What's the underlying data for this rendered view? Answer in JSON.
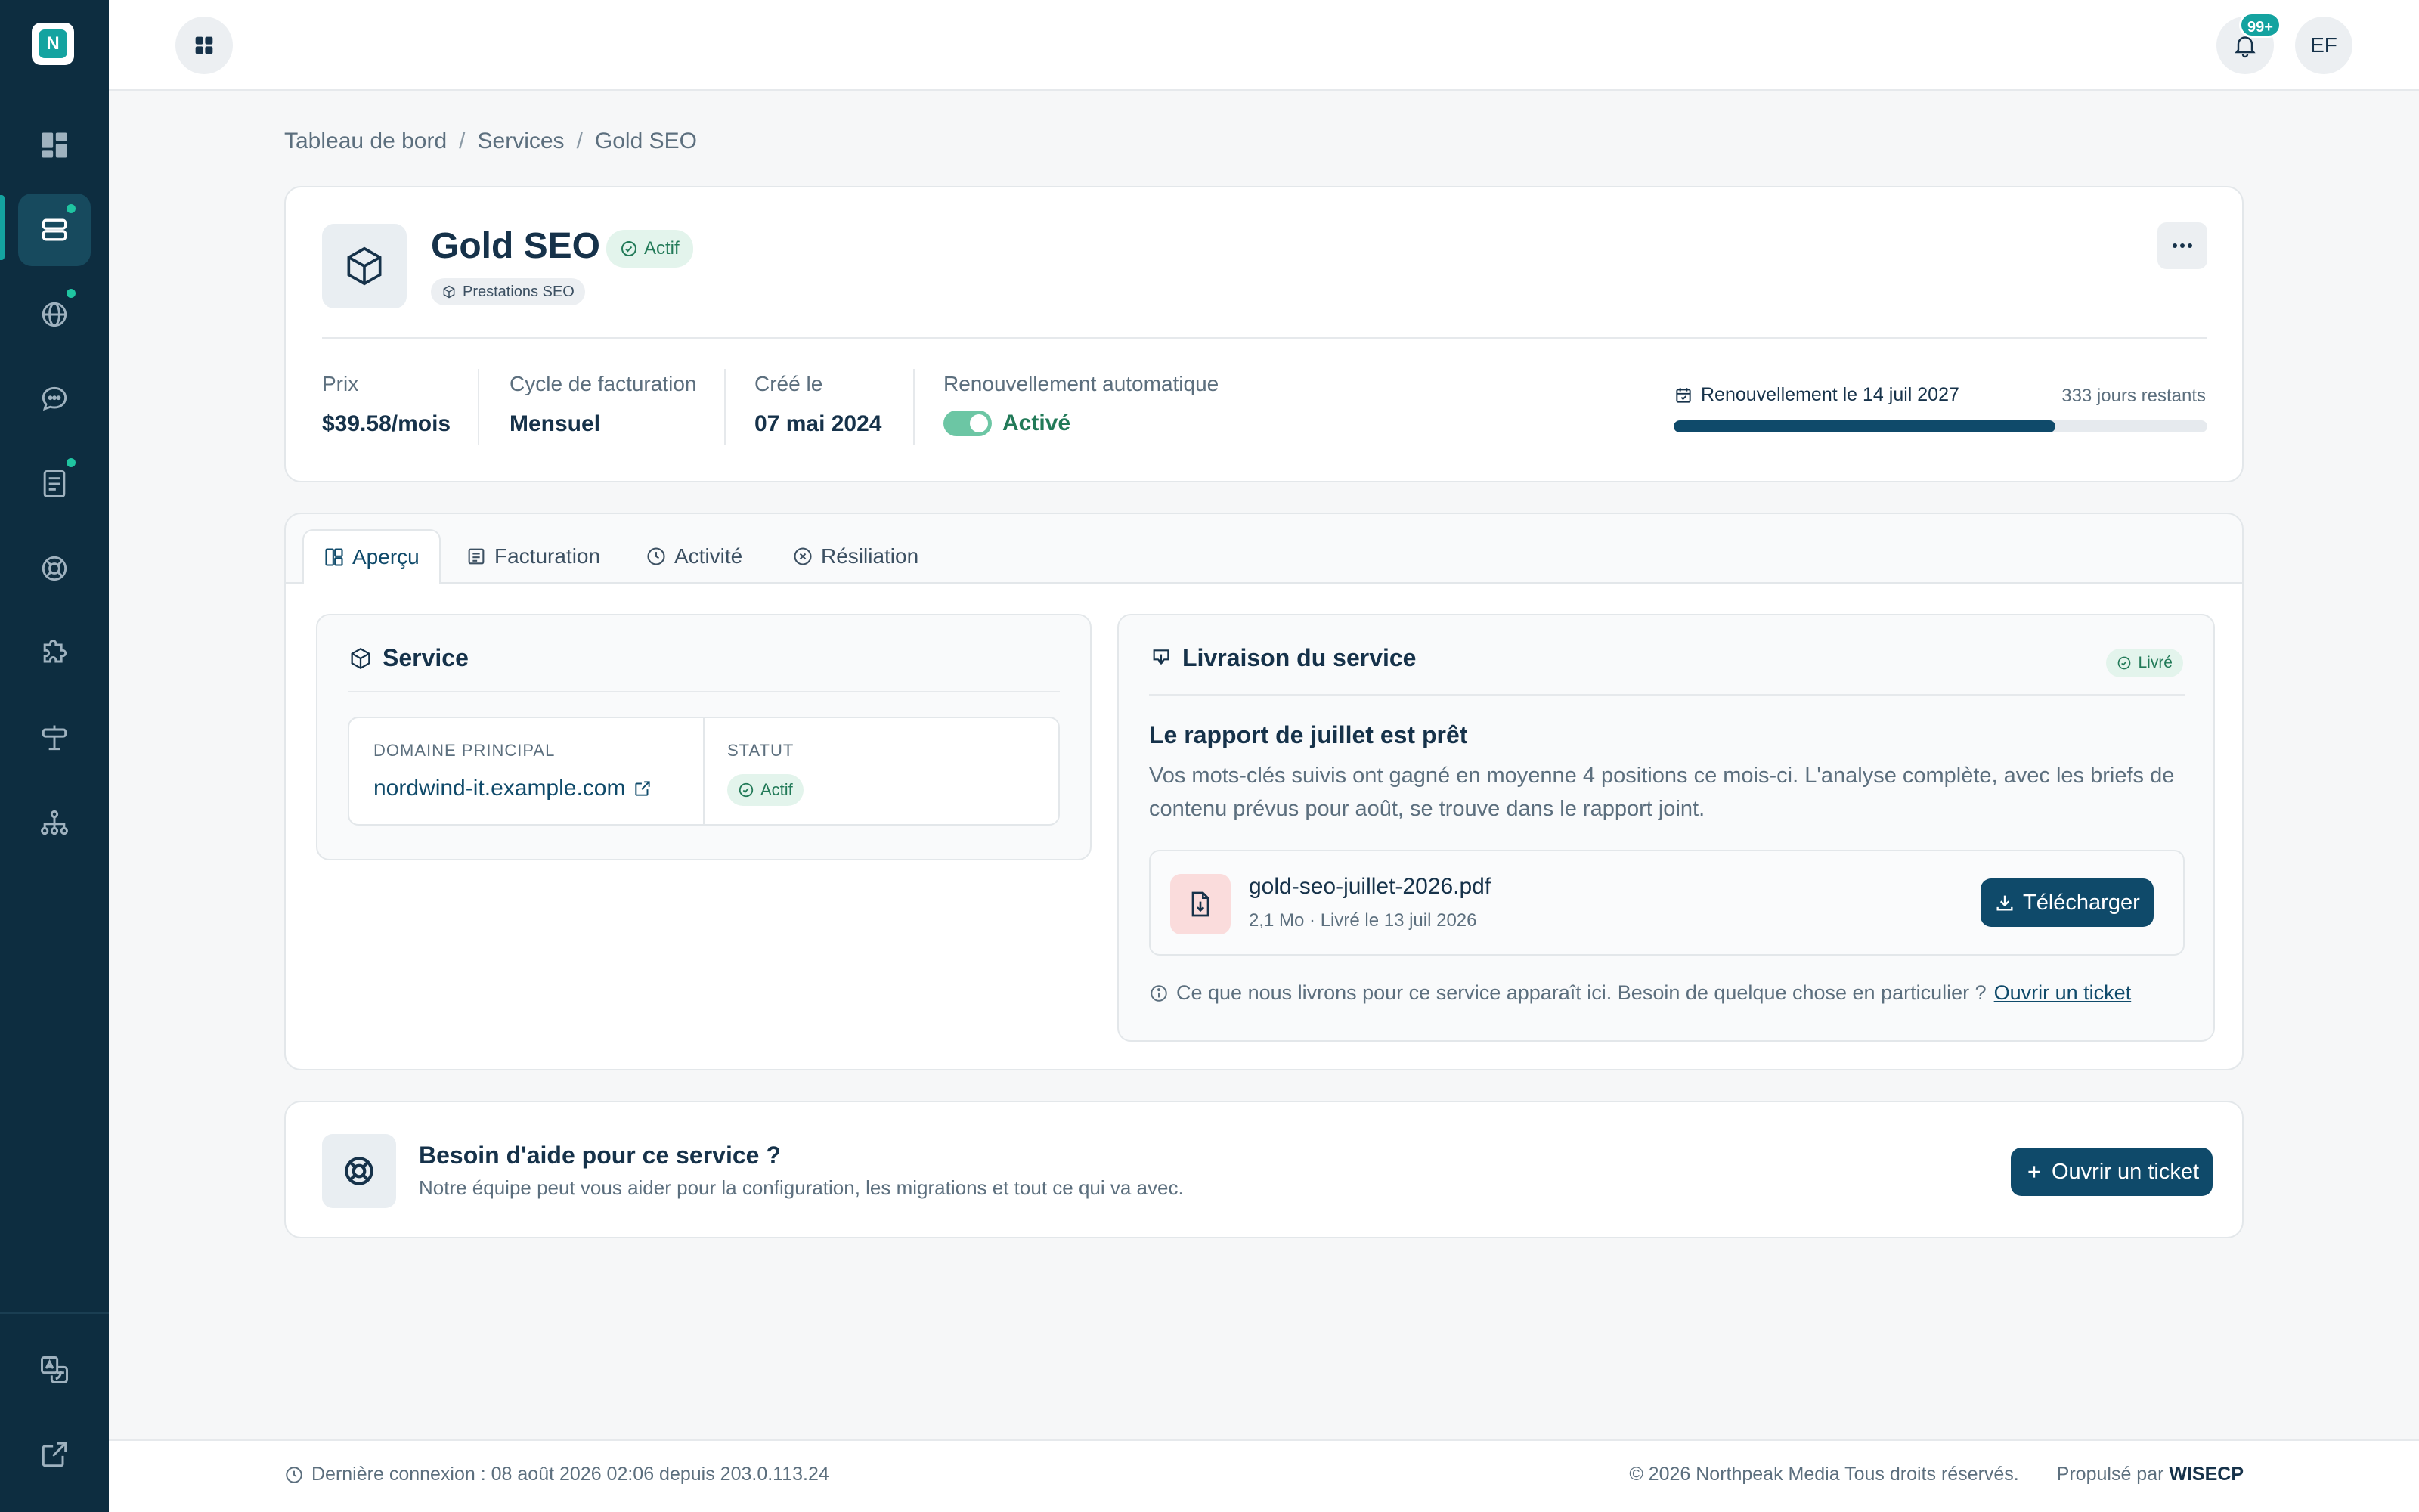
{
  "logo": {
    "letter": "N"
  },
  "sidebar": {
    "items": [
      {
        "icon": "dashboard-icon",
        "active": false,
        "dot": false
      },
      {
        "icon": "services-icon",
        "active": true,
        "dot": true
      },
      {
        "icon": "globe-icon",
        "active": false,
        "dot": true
      },
      {
        "icon": "chat-icon",
        "active": false,
        "dot": false
      },
      {
        "icon": "invoice-icon",
        "active": false,
        "dot": true
      },
      {
        "icon": "lifebuoy-icon",
        "active": false,
        "dot": false
      },
      {
        "icon": "puzzle-icon",
        "active": false,
        "dot": false
      },
      {
        "icon": "signpost-icon",
        "active": false,
        "dot": false
      },
      {
        "icon": "sitemap-icon",
        "active": false,
        "dot": false
      }
    ],
    "bottom": [
      {
        "icon": "translate-icon"
      },
      {
        "icon": "external-link-icon"
      }
    ]
  },
  "topbar": {
    "notification_count": "99+",
    "avatar_initials": "EF"
  },
  "breadcrumb": [
    "Tableau de bord",
    "Services",
    "Gold SEO"
  ],
  "service": {
    "title": "Gold SEO",
    "status": "Actif",
    "category": "Prestations SEO",
    "stats": [
      {
        "label": "Prix",
        "value": "$39.58/mois"
      },
      {
        "label": "Cycle de facturation",
        "value": "Mensuel"
      },
      {
        "label": "Créé le",
        "value": "07 mai 2024"
      }
    ],
    "auto_renew": {
      "label": "Renouvellement automatique",
      "value": "Activé",
      "on": true
    },
    "renewal": {
      "label": "Renouvellement le 14 juil 2027",
      "days_left": "333 jours restants",
      "progress": 0.716
    }
  },
  "tabs": [
    {
      "label": "Aperçu",
      "icon": "overview-icon",
      "active": true
    },
    {
      "label": "Facturation",
      "icon": "billing-icon",
      "active": false
    },
    {
      "label": "Activité",
      "icon": "clock-icon",
      "active": false
    },
    {
      "label": "Résiliation",
      "icon": "cancel-circle-icon",
      "active": false
    }
  ],
  "service_panel": {
    "title": "Service",
    "domain_header": "DOMAINE PRINCIPAL",
    "domain": "nordwind-it.example.com",
    "status_header": "STATUT",
    "status": "Actif"
  },
  "delivery": {
    "title": "Livraison du service",
    "badge": "Livré",
    "heading": "Le rapport de juillet est prêt",
    "text": "Vos mots-clés suivis ont gagné en moyenne 4 positions ce mois-ci. L'analyse complète, avec les briefs de contenu prévus pour août, se trouve dans le rapport joint.",
    "file_name": "gold-seo-juillet-2026.pdf",
    "file_meta": "2,1 Mo · Livré le 13 juil 2026",
    "download_label": "Télécharger",
    "note": "Ce que nous livrons pour ce service apparaît ici. Besoin de quelque chose en particulier ?",
    "note_link": "Ouvrir un ticket"
  },
  "help": {
    "title": "Besoin d'aide pour ce service ?",
    "subtitle": "Notre équipe peut vous aider pour la configuration, les migrations et tout ce qui va avec.",
    "button": "Ouvrir un ticket"
  },
  "footer": {
    "last_login": "Dernière connexion : 08 août 2026 02:06 depuis 203.0.113.24",
    "copyright": "© 2026 Northpeak Media Tous droits réservés.",
    "powered_prefix": "Propulsé par",
    "powered_brand": "WISECP"
  },
  "colors": {
    "sidebar": "#0d2d40",
    "accent": "#14a3a0",
    "primary_button": "#0f4a6a",
    "success": "#227a58"
  }
}
